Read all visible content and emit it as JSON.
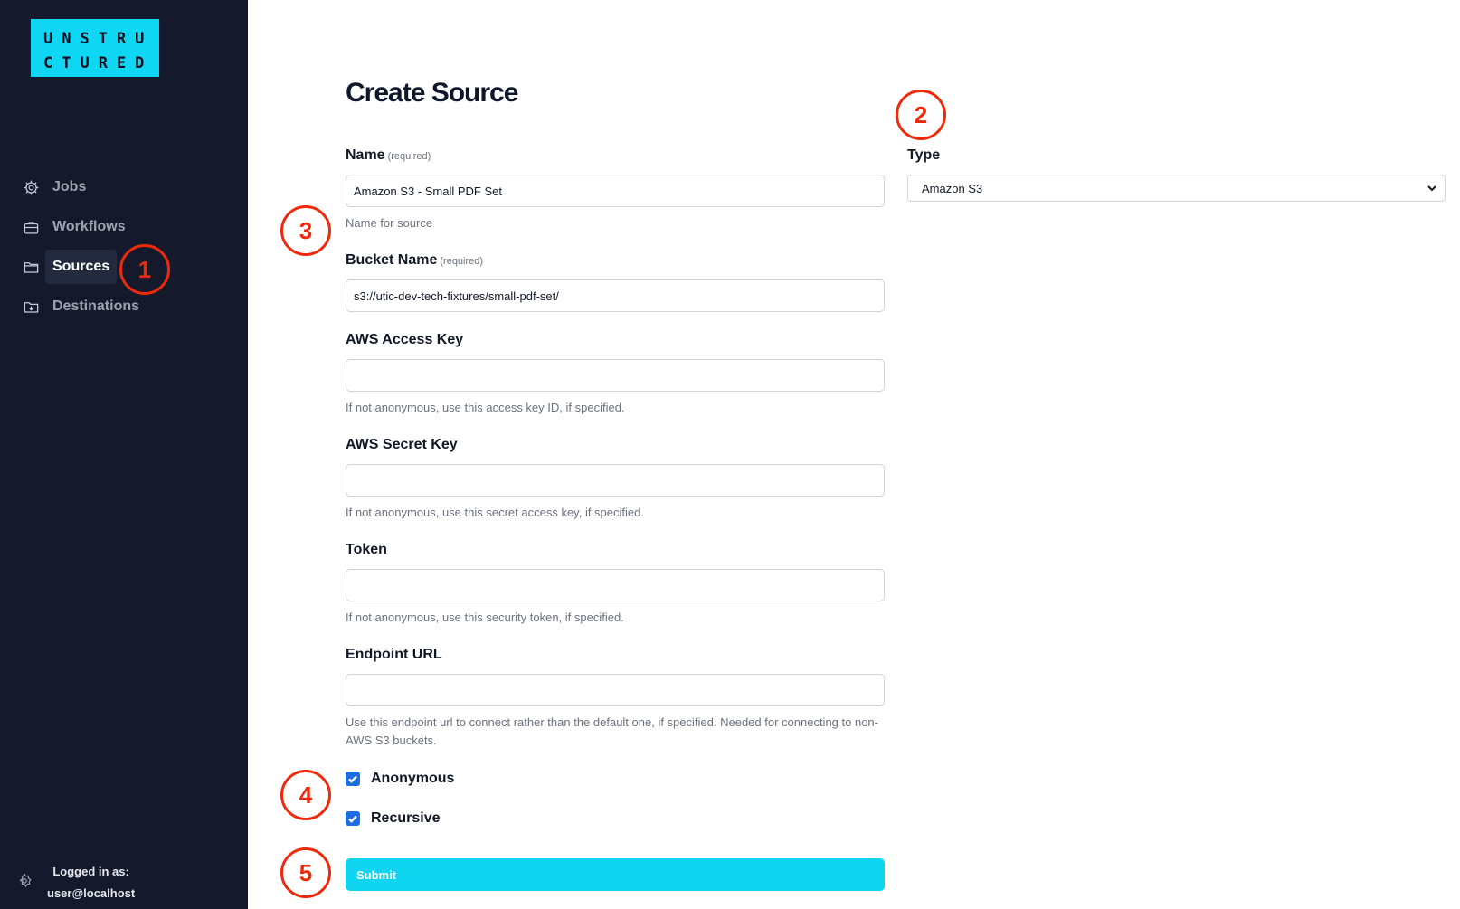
{
  "logo": {
    "line1": "UNSTRU",
    "line2": "CTURED"
  },
  "sidebar": {
    "items": [
      {
        "label": "Jobs",
        "icon": "jobs-gear-icon"
      },
      {
        "label": "Workflows",
        "icon": "briefcase-icon"
      },
      {
        "label": "Sources",
        "icon": "folder-icon",
        "active": true
      },
      {
        "label": "Destinations",
        "icon": "folder-download-icon"
      }
    ],
    "footer": {
      "line1": "Logged in as:",
      "line2": "user@localhost",
      "icon": "settings-icon"
    }
  },
  "page": {
    "title": "Create Source"
  },
  "form": {
    "name": {
      "label": "Name",
      "required": "(required)",
      "value": "Amazon S3 - Small PDF Set",
      "help": "Name for source"
    },
    "type": {
      "label": "Type",
      "value": "Amazon S3"
    },
    "bucket": {
      "label": "Bucket Name",
      "required": "(required)",
      "value": "s3://utic-dev-tech-fixtures/small-pdf-set/"
    },
    "access_key": {
      "label": "AWS Access Key",
      "value": "",
      "help": "If not anonymous, use this access key ID, if specified."
    },
    "secret_key": {
      "label": "AWS Secret Key",
      "value": "",
      "help": "If not anonymous, use this secret access key, if specified."
    },
    "token": {
      "label": "Token",
      "value": "",
      "help": "If not anonymous, use this security token, if specified."
    },
    "endpoint": {
      "label": "Endpoint URL",
      "value": "",
      "help_line1": "Use this endpoint url to connect rather than the default one, if specified. Needed for connecting to non-",
      "help_line2": "AWS S3 buckets."
    },
    "anonymous": {
      "label": "Anonymous",
      "checked": true
    },
    "recursive": {
      "label": "Recursive",
      "checked": true
    },
    "submit_label": "Submit"
  },
  "annotations": [
    "1",
    "2",
    "3",
    "4",
    "5"
  ],
  "colors": {
    "sidebar": "#141a2b",
    "accent": "#10d5f1",
    "marker": "#ee2a0d",
    "checkbox": "#1d6fe0"
  }
}
